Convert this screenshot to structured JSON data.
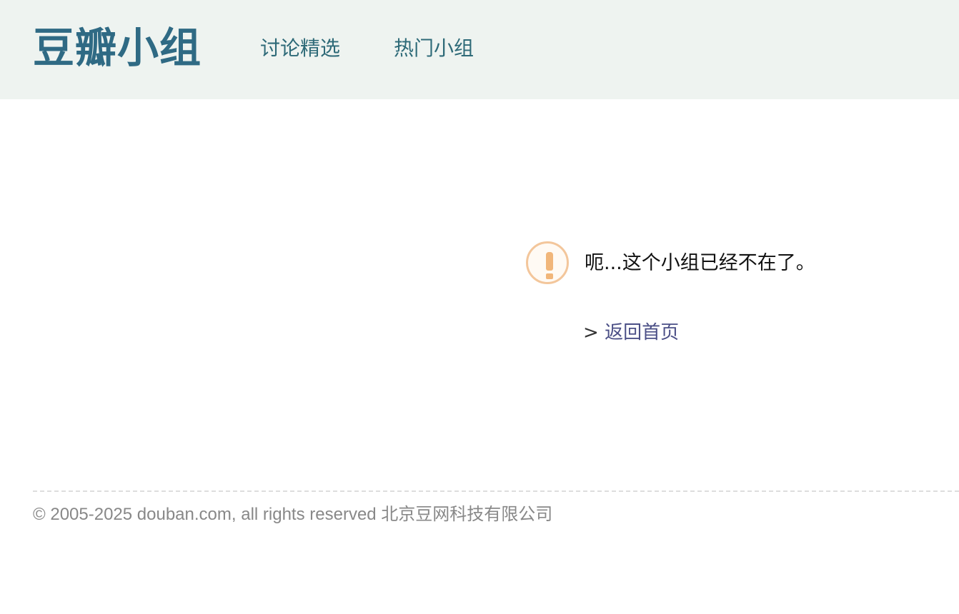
{
  "header": {
    "logo": "豆瓣小组",
    "nav": [
      {
        "label": "讨论精选"
      },
      {
        "label": "热门小组"
      }
    ]
  },
  "notice": {
    "icon": "exclamation-icon",
    "message": "呃...这个小组已经不在了。",
    "back_prefix": ">",
    "back_link": "返回首页"
  },
  "footer": {
    "copyright": "© 2005-2025 douban.com, all rights reserved 北京豆网科技有限公司"
  },
  "colors": {
    "header_bg": "#eef3f0",
    "logo": "#2f6a84",
    "nav": "#2e6a78",
    "link": "#4b4f86",
    "warning": "#f1b67a"
  }
}
